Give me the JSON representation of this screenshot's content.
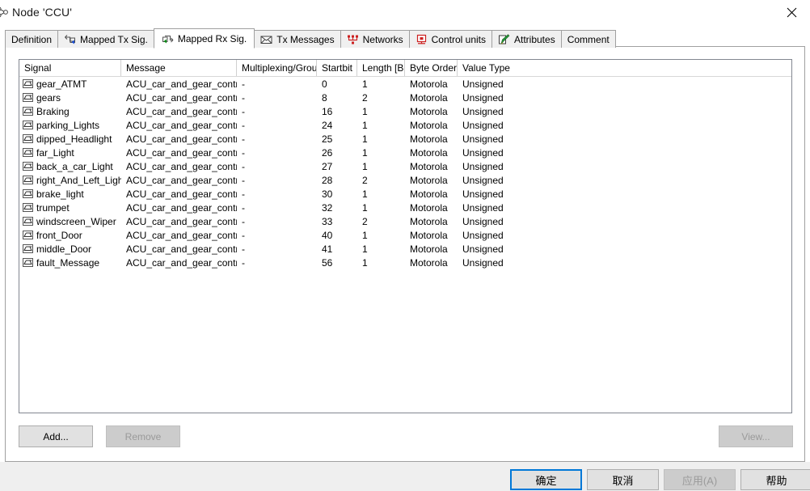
{
  "window": {
    "title": "Node 'CCU'",
    "icon": "node-icon",
    "close_label": "✕"
  },
  "tabs": [
    {
      "label": "Definition",
      "icon": null,
      "active": false
    },
    {
      "label": "Mapped Tx Sig.",
      "icon": "tx-signal-icon",
      "active": false
    },
    {
      "label": "Mapped Rx Sig.",
      "icon": "rx-signal-icon",
      "active": true
    },
    {
      "label": "Tx Messages",
      "icon": "envelope-icon",
      "active": false
    },
    {
      "label": "Networks",
      "icon": "network-icon",
      "active": false
    },
    {
      "label": "Control units",
      "icon": "control-unit-icon",
      "active": false
    },
    {
      "label": "Attributes",
      "icon": "attributes-icon",
      "active": false
    },
    {
      "label": "Comment",
      "icon": null,
      "active": false
    }
  ],
  "table": {
    "columns": [
      {
        "key": "signal",
        "label": "Signal"
      },
      {
        "key": "message",
        "label": "Message"
      },
      {
        "key": "mux",
        "label": "Multiplexing/Group"
      },
      {
        "key": "start",
        "label": "Startbit"
      },
      {
        "key": "length",
        "label": "Length [Bit]"
      },
      {
        "key": "border",
        "label": "Byte Order"
      },
      {
        "key": "value",
        "label": "Value Type"
      }
    ],
    "rows": [
      {
        "signal": "gear_ATMT",
        "message": "ACU_car_and_gear_control",
        "mux": "-",
        "start": "0",
        "length": "1",
        "border": "Motorola",
        "value": "Unsigned"
      },
      {
        "signal": "gears",
        "message": "ACU_car_and_gear_control",
        "mux": "-",
        "start": "8",
        "length": "2",
        "border": "Motorola",
        "value": "Unsigned"
      },
      {
        "signal": "Braking",
        "message": "ACU_car_and_gear_control",
        "mux": "-",
        "start": "16",
        "length": "1",
        "border": "Motorola",
        "value": "Unsigned"
      },
      {
        "signal": "parking_Lights",
        "message": "ACU_car_and_gear_control",
        "mux": "-",
        "start": "24",
        "length": "1",
        "border": "Motorola",
        "value": "Unsigned"
      },
      {
        "signal": "dipped_Headlight",
        "message": "ACU_car_and_gear_control",
        "mux": "-",
        "start": "25",
        "length": "1",
        "border": "Motorola",
        "value": "Unsigned"
      },
      {
        "signal": "far_Light",
        "message": "ACU_car_and_gear_control",
        "mux": "-",
        "start": "26",
        "length": "1",
        "border": "Motorola",
        "value": "Unsigned"
      },
      {
        "signal": "back_a_car_Light",
        "message": "ACU_car_and_gear_control",
        "mux": "-",
        "start": "27",
        "length": "1",
        "border": "Motorola",
        "value": "Unsigned"
      },
      {
        "signal": "right_And_Left_Light",
        "message": "ACU_car_and_gear_control",
        "mux": "-",
        "start": "28",
        "length": "2",
        "border": "Motorola",
        "value": "Unsigned"
      },
      {
        "signal": "brake_light",
        "message": "ACU_car_and_gear_control",
        "mux": "-",
        "start": "30",
        "length": "1",
        "border": "Motorola",
        "value": "Unsigned"
      },
      {
        "signal": "trumpet",
        "message": "ACU_car_and_gear_control",
        "mux": "-",
        "start": "32",
        "length": "1",
        "border": "Motorola",
        "value": "Unsigned"
      },
      {
        "signal": "windscreen_Wiper",
        "message": "ACU_car_and_gear_control",
        "mux": "-",
        "start": "33",
        "length": "2",
        "border": "Motorola",
        "value": "Unsigned"
      },
      {
        "signal": "front_Door",
        "message": "ACU_car_and_gear_control",
        "mux": "-",
        "start": "40",
        "length": "1",
        "border": "Motorola",
        "value": "Unsigned"
      },
      {
        "signal": "middle_Door",
        "message": "ACU_car_and_gear_control",
        "mux": "-",
        "start": "41",
        "length": "1",
        "border": "Motorola",
        "value": "Unsigned"
      },
      {
        "signal": "fault_Message",
        "message": "ACU_car_and_gear_control",
        "mux": "-",
        "start": "56",
        "length": "1",
        "border": "Motorola",
        "value": "Unsigned"
      }
    ]
  },
  "actions": {
    "add": "Add...",
    "remove": "Remove",
    "view": "View..."
  },
  "footer": {
    "ok": "确定",
    "cancel": "取消",
    "apply": "应用(A)",
    "help": "帮助"
  },
  "colors": {
    "accent": "#0078d7",
    "panel_border": "#a0a0a0",
    "list_border": "#828790",
    "footer_bg": "#efefef",
    "button_bg": "#e1e1e1",
    "disabled_text": "#9a9a9a"
  }
}
